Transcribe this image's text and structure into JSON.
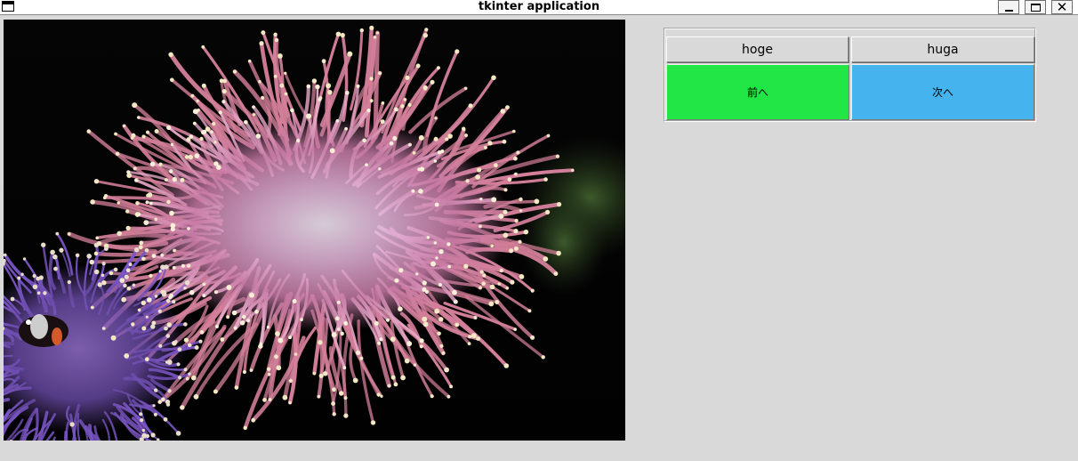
{
  "window": {
    "title": "tkinter application"
  },
  "image": {
    "subject": "sea anemone with clownfish on black background"
  },
  "panel": {
    "buttons": {
      "hoge": "hoge",
      "huga": "huga",
      "prev": "前へ",
      "next": "次へ"
    },
    "colors": {
      "prev_bg": "#22e646",
      "next_bg": "#45b3ee"
    }
  },
  "icons": {
    "app": "window-icon",
    "minimize": "minimize-icon",
    "maximize": "maximize-icon",
    "close": "close-icon"
  }
}
